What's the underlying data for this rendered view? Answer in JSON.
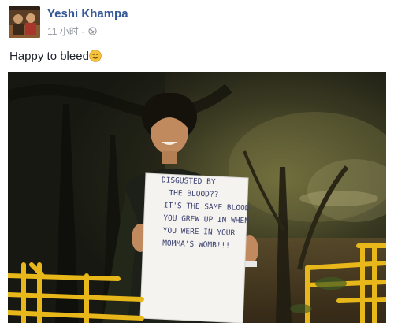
{
  "post": {
    "author": "Yeshi Khampa",
    "timestamp": "11 小时",
    "separator": "·",
    "privacy_icon": "globe-icon",
    "text": "Happy to bleed",
    "emoji": "smiling-face-emoji"
  },
  "photo": {
    "sign_lines": [
      "DISGUSTED BY",
      "THE BLOOD??",
      "IT'S THE SAME BLOOD",
      "YOU GREW UP IN WHEN",
      "YOU WERE IN YOUR",
      "MOMMA'S WOMB!!!"
    ]
  },
  "colors": {
    "author_link": "#365899",
    "meta_gray": "#90949c",
    "body_text": "#1d2129",
    "railing_yellow": "#e8b81a"
  }
}
